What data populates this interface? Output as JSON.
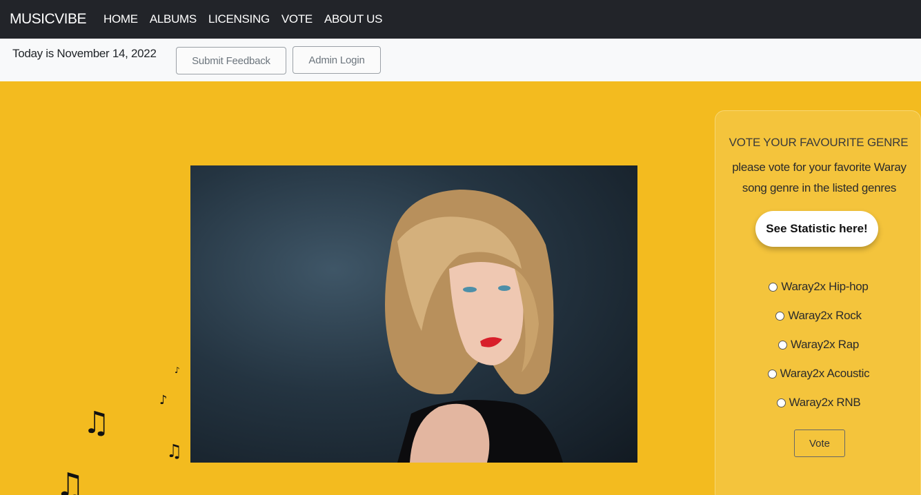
{
  "navbar": {
    "brand": "MUSICVIBE",
    "links": [
      "HOME",
      "ALBUMS",
      "LICENSING",
      "VOTE",
      "ABOUT US"
    ]
  },
  "subbar": {
    "date_text": "Today is November 14, 2022",
    "feedback_label": "Submit Feedback",
    "admin_label": "Admin Login"
  },
  "vote": {
    "title": "VOTE YOUR FAVOURITE GENRE",
    "description": "please vote for your favorite Waray song genre in the listed genres",
    "stat_button": "See Statistic here!",
    "genres": [
      "Waray2x Hip-hop",
      "Waray2x Rock",
      "Waray2x Rap",
      "Waray2x Acoustic",
      "Waray2x RNB"
    ],
    "vote_button": "Vote"
  },
  "colors": {
    "navbar": "#222429",
    "page_background": "#f3bb1f",
    "subbar": "#f8f9fa",
    "vote_panel": "#f4c43c"
  },
  "icons": [
    "music-note-icon"
  ]
}
